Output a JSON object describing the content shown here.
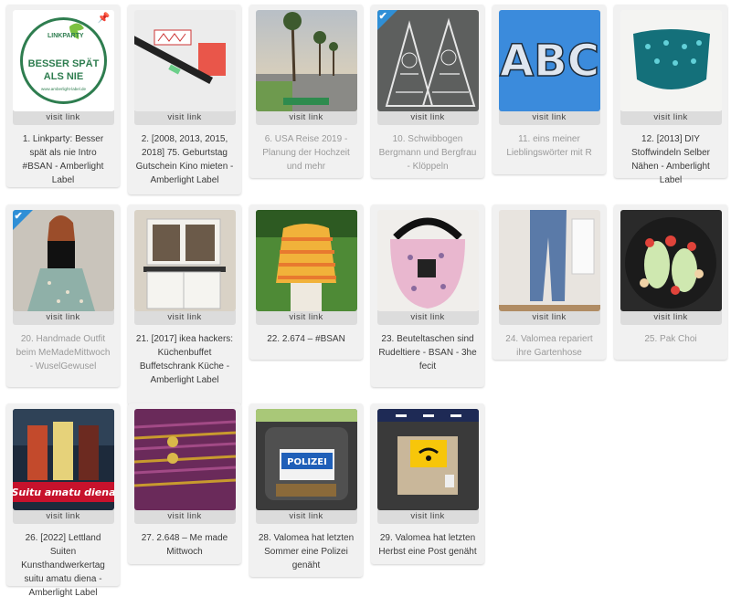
{
  "visit_label": "visit link",
  "colors": {
    "card_bg": "#f1f1f1",
    "visit_bg": "#dcdcdc",
    "check_blue": "#2f8fd6"
  },
  "cards": [
    {
      "caption": "1. Linkparty: Besser spät als nie Intro #BSAN - Amberlight Label",
      "visited": false,
      "pinned": true,
      "checked": false,
      "logo": {
        "top": "LINKPARTY",
        "line1": "BESSER SPÄT",
        "line2": "ALS NIE",
        "url": "www.amberlight-label.de"
      }
    },
    {
      "caption": "2. [2008, 2013, 2015, 2018] 75. Geburtstag Gutschein Kino mieten - Amberlight Label",
      "visited": false,
      "pinned": false,
      "checked": false
    },
    {
      "caption": "6. USA Reise 2019 - Planung der Hochzeit und mehr",
      "visited": true,
      "pinned": false,
      "checked": false
    },
    {
      "caption": "10. Schwibbogen Bergmann und Bergfrau - Klöppeln",
      "visited": true,
      "pinned": false,
      "checked": true
    },
    {
      "caption": "11. eins meiner Lieblingswörter mit R",
      "visited": true,
      "pinned": false,
      "checked": false,
      "letters": "ABC"
    },
    {
      "caption": "12. [2013] DIY Stoffwindeln Selber Nähen - Amberlight Label",
      "visited": false,
      "pinned": false,
      "checked": false
    },
    {
      "caption": "20. Handmade Outfit beim MeMadeMittwoch - WuselGewusel",
      "visited": true,
      "pinned": false,
      "checked": true
    },
    {
      "caption": "21. [2017] ikea hackers: Küchenbuffet Buffetschrank Küche - Amberlight Label",
      "visited": false,
      "pinned": false,
      "checked": false
    },
    {
      "caption": "22. 2.674 – #BSAN",
      "visited": false,
      "pinned": false,
      "checked": false
    },
    {
      "caption": "23. Beuteltaschen sind Rudeltiere - BSAN - 3he fecit",
      "visited": false,
      "pinned": false,
      "checked": false
    },
    {
      "caption": "24. Valomea repariert ihre Gartenhose",
      "visited": true,
      "pinned": false,
      "checked": false
    },
    {
      "caption": "25. Pak Choi",
      "visited": true,
      "pinned": false,
      "checked": false
    },
    {
      "caption": "26. [2022] Lettland Suiten Kunsthandwerkertag suitu amatu diena - Amberlight Label",
      "visited": false,
      "pinned": false,
      "checked": false,
      "banner": "Suitu amatu diena"
    },
    {
      "caption": "27. 2.648 – Me made Mittwoch",
      "visited": false,
      "pinned": false,
      "checked": false
    },
    {
      "caption": "28. Valomea hat letzten Sommer eine Polizei genäht",
      "visited": false,
      "pinned": false,
      "checked": false,
      "sign": "POLIZEI"
    },
    {
      "caption": "29. Valomea hat letzten Herbst eine Post genäht",
      "visited": false,
      "pinned": false,
      "checked": false
    }
  ]
}
